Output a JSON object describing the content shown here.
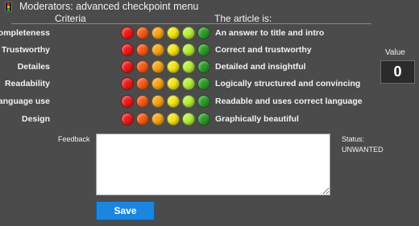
{
  "window": {
    "title": "Moderators: advanced checkpoint menu"
  },
  "headers": {
    "criteria": "Criteria",
    "article": "The article is:"
  },
  "rating_colors": [
    "#ee1b1b",
    "#f45a16",
    "#f7a418",
    "#f3e61a",
    "#b7ef3a",
    "#2f9a2a"
  ],
  "rows": [
    {
      "label": "Completeness",
      "description": "An answer to title and intro"
    },
    {
      "label": "Trustworthy",
      "description": "Correct and trustworthy"
    },
    {
      "label": "Detailes",
      "description": "Detailed and insightful"
    },
    {
      "label": "Readability",
      "description": "Logically structured and convincing"
    },
    {
      "label": "Language use",
      "description": "Readable and uses correct language"
    },
    {
      "label": "Design",
      "description": "Graphically beautiful"
    }
  ],
  "value": {
    "label": "Value",
    "number": "0"
  },
  "feedback": {
    "label": "Feedback",
    "value": ""
  },
  "status": {
    "label": "Status:",
    "value": "UNWANTED"
  },
  "save": {
    "label": "Save"
  },
  "icons": {
    "title_icon": "traffic-light-icon"
  }
}
